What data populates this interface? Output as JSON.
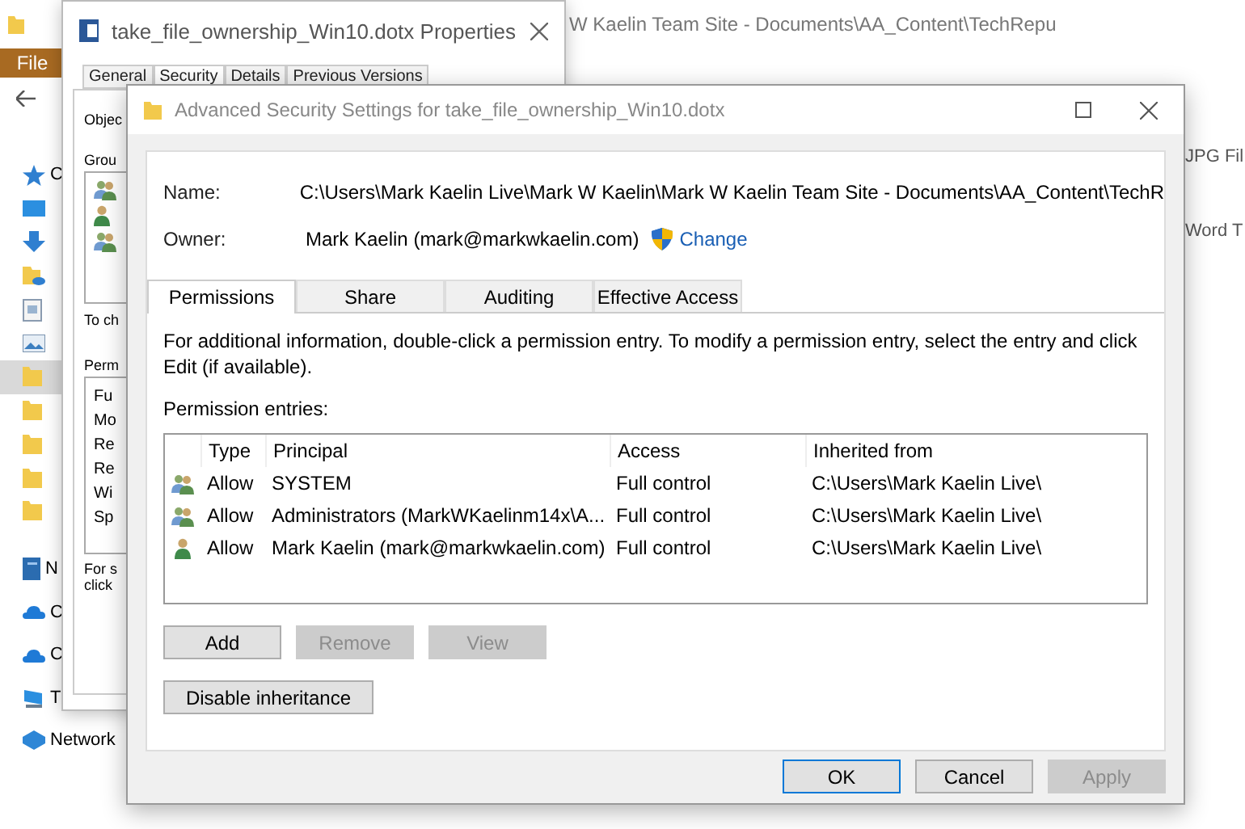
{
  "explorer": {
    "title": "W Kaelin Team Site - Documents\\AA_Content\\TechRepu",
    "file_tab": "File",
    "nav_items": [
      {
        "kind": "star",
        "label": "C",
        "selected": false
      },
      {
        "kind": "desktop",
        "selected": false
      },
      {
        "kind": "download",
        "selected": false
      },
      {
        "kind": "cloud-folder",
        "selected": false
      },
      {
        "kind": "document",
        "selected": false
      },
      {
        "kind": "pictures",
        "selected": false
      },
      {
        "kind": "folder",
        "selected": true
      },
      {
        "kind": "folder",
        "selected": false
      },
      {
        "kind": "folder",
        "selected": false
      },
      {
        "kind": "folder",
        "selected": false
      },
      {
        "kind": "folder",
        "selected": false
      },
      {
        "kind": "notebook",
        "label": "N",
        "selected": false
      },
      {
        "kind": "cloud",
        "label": "C",
        "selected": false
      },
      {
        "kind": "cloud",
        "label": "C",
        "selected": false
      },
      {
        "kind": "computer",
        "label": "T",
        "selected": false
      },
      {
        "kind": "network",
        "label": "Network",
        "selected": false
      }
    ],
    "type_column": [
      "JPG Fil",
      "Word T"
    ]
  },
  "properties_window": {
    "title": "take_file_ownership_Win10.dotx Properties",
    "tabs": [
      {
        "label": "General",
        "selected": false
      },
      {
        "label": "Security",
        "selected": true
      },
      {
        "label": "Details",
        "selected": false
      },
      {
        "label": "Previous Versions",
        "selected": false
      }
    ],
    "object_label": "Objec",
    "group_label": "Grou",
    "group_icons": [
      {
        "kind": "group"
      },
      {
        "kind": "user"
      },
      {
        "kind": "group"
      }
    ],
    "change_label": "To ch",
    "permissions_label": "Perm",
    "permission_items": [
      "Fu",
      "Mo",
      "Re",
      "Re",
      "Wi",
      "Sp"
    ],
    "note": [
      "For s",
      "click"
    ]
  },
  "advanced_window": {
    "title": "Advanced Security Settings for take_file_ownership_Win10.dotx",
    "name_label": "Name:",
    "name_value": "C:\\Users\\Mark Kaelin Live\\Mark W Kaelin\\Mark W Kaelin Team Site - Documents\\AA_Content\\TechR",
    "owner_label": "Owner:",
    "owner_value": "Mark Kaelin (mark@markwkaelin.com)",
    "change_link": "Change",
    "tabs": [
      {
        "label": "Permissions",
        "selected": true
      },
      {
        "label": "Share",
        "selected": false
      },
      {
        "label": "Auditing",
        "selected": false
      },
      {
        "label": "Effective Access",
        "selected": false
      }
    ],
    "info": "For additional information, double-click a permission entry. To modify a permission entry, select the entry and click Edit (if available).",
    "entries_label": "Permission entries:",
    "table": {
      "columns": [
        "Type",
        "Principal",
        "Access",
        "Inherited from"
      ],
      "rows": [
        {
          "kind": "group",
          "type": "Allow",
          "principal": "SYSTEM",
          "access": "Full control",
          "inherited_from": "C:\\Users\\Mark Kaelin Live\\"
        },
        {
          "kind": "group",
          "type": "Allow",
          "principal": "Administrators (MarkWKaelinm14x\\A...",
          "access": "Full control",
          "inherited_from": "C:\\Users\\Mark Kaelin Live\\"
        },
        {
          "kind": "user",
          "type": "Allow",
          "principal": "Mark Kaelin (mark@markwkaelin.com)",
          "access": "Full control",
          "inherited_from": "C:\\Users\\Mark Kaelin Live\\"
        }
      ]
    },
    "entry_buttons": [
      {
        "label": "Add",
        "disabled": false
      },
      {
        "label": "Remove",
        "disabled": true
      },
      {
        "label": "View",
        "disabled": true
      }
    ],
    "inheritance_button": {
      "label": "Disable inheritance",
      "disabled": false
    },
    "footer_buttons": [
      {
        "label": "OK",
        "disabled": false,
        "focused": true
      },
      {
        "label": "Cancel",
        "disabled": false,
        "focused": false
      },
      {
        "label": "Apply",
        "disabled": true,
        "focused": false
      }
    ]
  }
}
